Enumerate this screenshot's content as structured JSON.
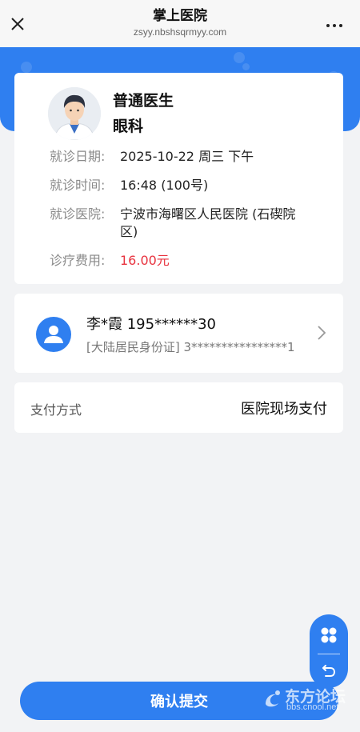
{
  "header": {
    "title": "掌上医院",
    "url": "zsyy.nbshsqrmyy.com",
    "close_icon": "close-icon",
    "more_icon": "more-dots-icon"
  },
  "doctor": {
    "name": "普通医生",
    "department": "眼科"
  },
  "visit": {
    "date_label": "就诊日期:",
    "date_value": "2025-10-22 周三 下午",
    "time_label": "就诊时间:",
    "time_value": "16:48 (100号)",
    "hospital_label": "就诊医院:",
    "hospital_value": "宁波市海曙区人民医院 (石碶院区)",
    "fee_label": "诊疗费用:",
    "fee_value": "16.00元"
  },
  "patient": {
    "name_phone": "李*霞 195******30",
    "id_info": "[大陆居民身份证] 3****************1"
  },
  "payment": {
    "label": "支付方式",
    "value": "医院现场支付"
  },
  "submit": {
    "label": "确认提交"
  },
  "watermark": {
    "main": "东方论坛",
    "sub": "bbs.cnool.net"
  },
  "colors": {
    "primary": "#2f7ff0",
    "price": "#e8333f"
  }
}
